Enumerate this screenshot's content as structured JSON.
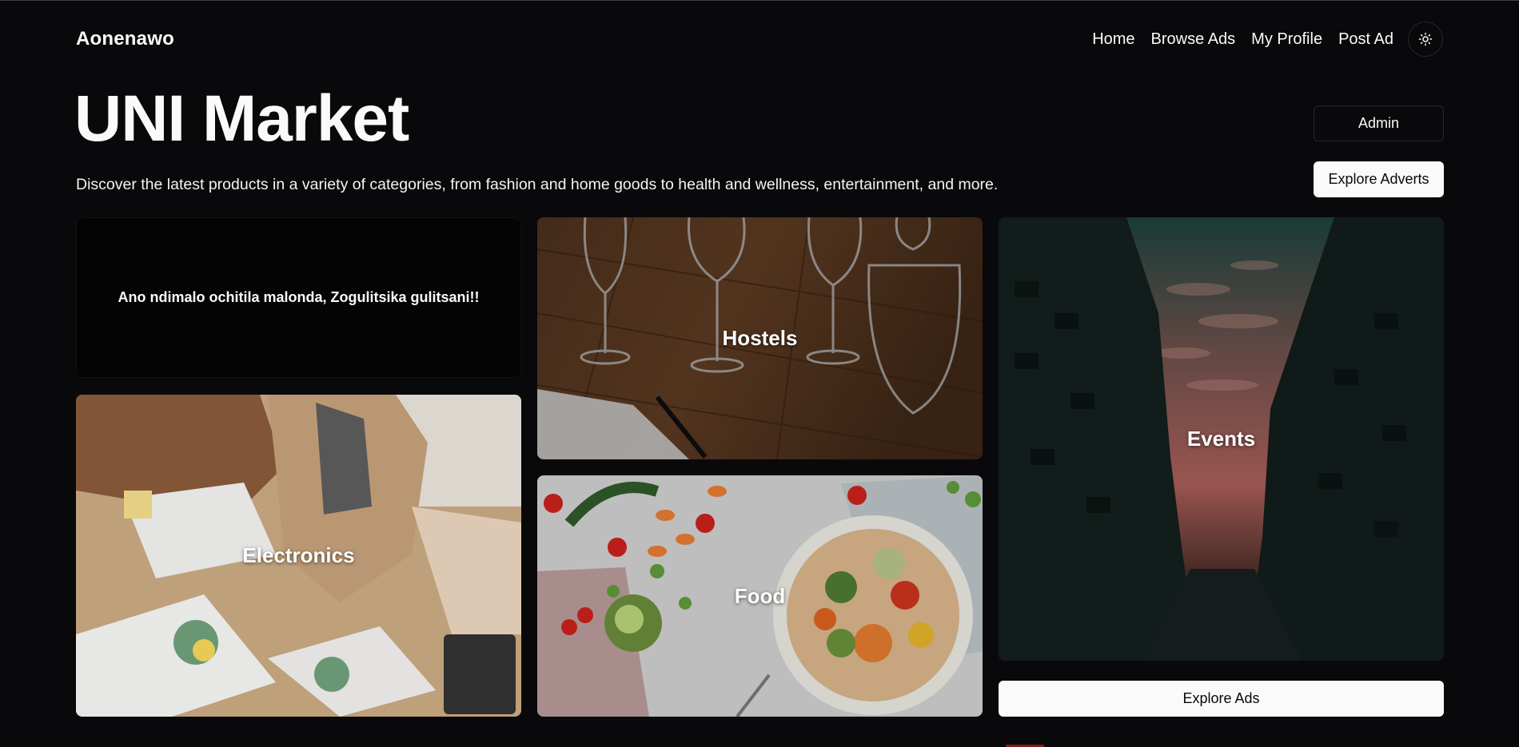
{
  "brand": "Aonenawo",
  "nav": {
    "links": [
      "Home",
      "Browse Ads",
      "My Profile",
      "Post Ad"
    ],
    "theme_icon": "sun-icon"
  },
  "hero": {
    "title": "UNI Market",
    "subtitle": "Discover the latest products in a variety of categories, from fashion and home goods to health and wellness, entertainment, and more.",
    "admin_button": "Admin",
    "explore_adverts_button": "Explore Adverts"
  },
  "tiles": {
    "quote": "Ano ndimalo ochitila malonda, Zogulitsika gulitsani!!",
    "hostels": "Hostels",
    "events": "Events",
    "electronics": "Electronics",
    "food": "Food"
  },
  "explore_ads_button": "Explore Ads",
  "colors": {
    "background": "#09090b",
    "foreground": "#fafafa",
    "border": "#27272a"
  }
}
